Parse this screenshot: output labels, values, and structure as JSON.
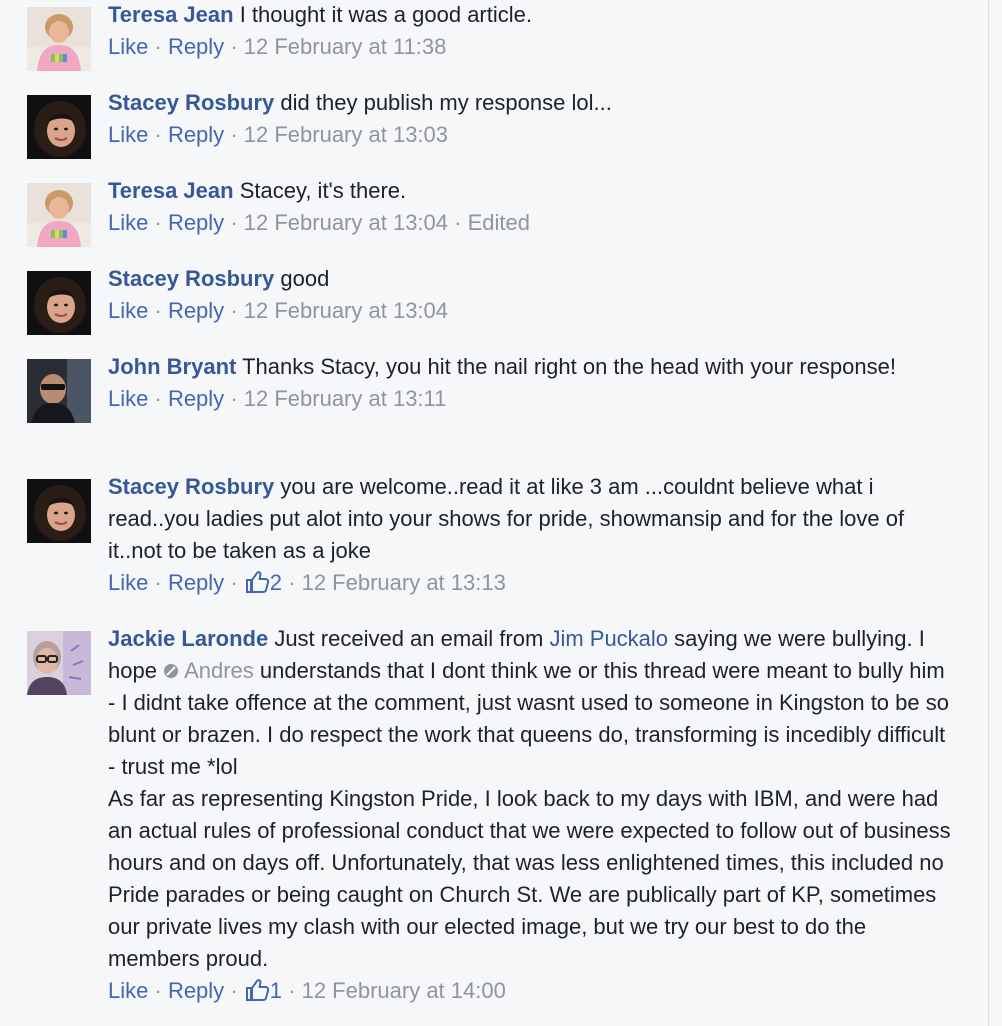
{
  "actions": {
    "like": "Like",
    "reply": "Reply",
    "dot": "·"
  },
  "comments": [
    {
      "author": "Teresa Jean",
      "text": "I thought it was a good article.",
      "timestamp": "12 February at 11:38"
    },
    {
      "author": "Stacey Rosbury",
      "text": "did they publish my response lol...",
      "timestamp": "12 February at 13:03"
    },
    {
      "author": "Teresa Jean",
      "text": "Stacey, it's there.",
      "timestamp": "12 February at 13:04",
      "edited": "Edited"
    },
    {
      "author": "Stacey Rosbury",
      "text": "good",
      "timestamp": "12 February at 13:04"
    },
    {
      "author": "John Bryant",
      "text": "Thanks Stacy, you hit the nail right on the head with your response!",
      "timestamp": "12 February at 13:11"
    },
    {
      "author": "Stacey Rosbury",
      "text": "you are welcome..read it at like 3 am ...couldnt believe what i read..you ladies put alot into your shows for pride, showmansip and for the love of it..not to be taken as a joke",
      "timestamp": "12 February at 13:13",
      "likes": "2"
    },
    {
      "author": "Jackie Laronde",
      "text_part1": "Just received an email from",
      "mention1": "Jim Puckalo",
      "text_part2": "saying we were bullying. I hope",
      "mention2": "Andres",
      "text_part3": "understands that I dont think we or this thread were meant to bully him - I didnt take offence at the comment, just wasnt used to someone in Kingston to be so blunt or brazen. I do respect the work that queens do, transforming is incedibly difficult - trust me *lol",
      "text_part4": "As far as representing Kingston Pride, I look back to my days with IBM, and were had an actual rules of professional conduct that we were expected to follow out of business hours and on days off. Unfortunately, that was less enlightened times, this included no Pride parades or being caught on Church St. We are publically part of KP, sometimes our private lives my clash with our elected image, but we try our best to do the members proud.",
      "timestamp": "12 February at 14:00",
      "likes": "1"
    }
  ],
  "colors": {
    "author": "#365899",
    "action_link": "#4267b2",
    "meta": "#90949c",
    "background": "#f6f7f9",
    "text": "#1d2129"
  }
}
